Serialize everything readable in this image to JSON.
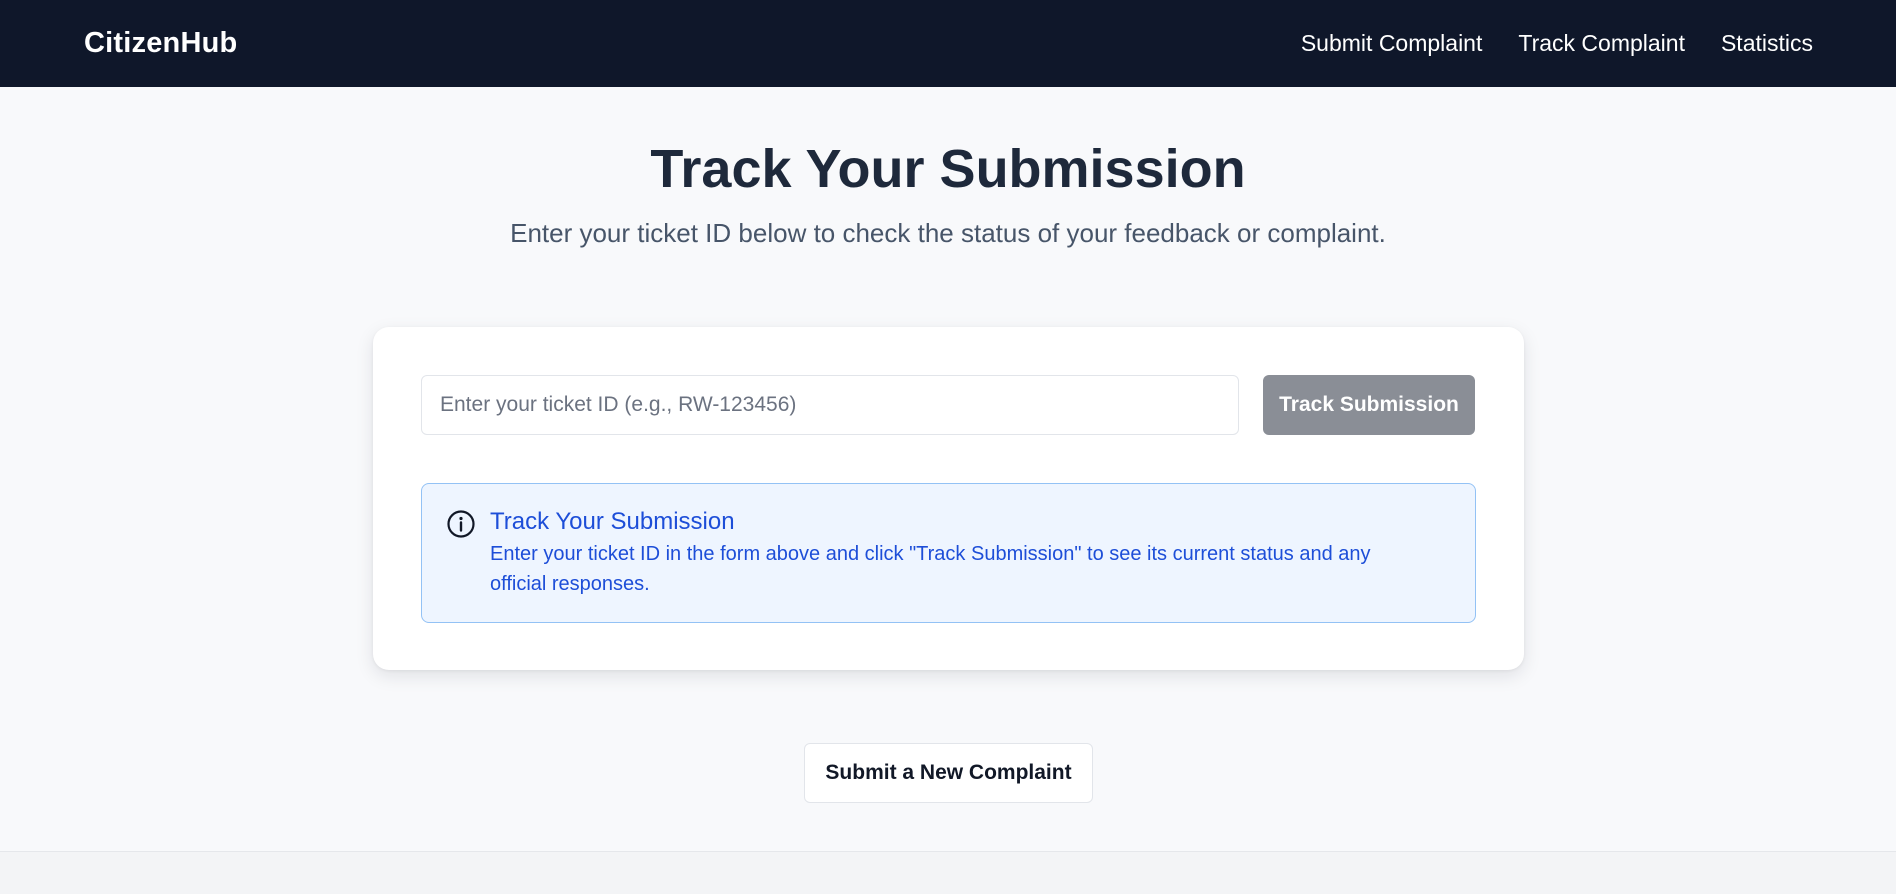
{
  "navbar": {
    "brand": "CitizenHub",
    "links": [
      {
        "label": "Submit Complaint"
      },
      {
        "label": "Track Complaint"
      },
      {
        "label": "Statistics"
      }
    ]
  },
  "hero": {
    "title": "Track Your Submission",
    "subtitle": "Enter your ticket ID below to check the status of your feedback or complaint."
  },
  "track_form": {
    "input_value": "",
    "input_placeholder": "Enter your ticket ID (e.g., RW-123456)",
    "button_label": "Track Submission",
    "button_color": "#8a8e96"
  },
  "info_box": {
    "icon": "info-icon",
    "title": "Track Your Submission",
    "body": "Enter your ticket ID in the form above and click \"Track Submission\" to see its current status and any official responses.",
    "accent_color": "#1d4ed8",
    "background_color": "#eef5ff"
  },
  "secondary_action": {
    "label": "Submit a New Complaint"
  },
  "colors": {
    "navbar_bg": "#0f172a",
    "page_bg": "#f8f9fb"
  }
}
